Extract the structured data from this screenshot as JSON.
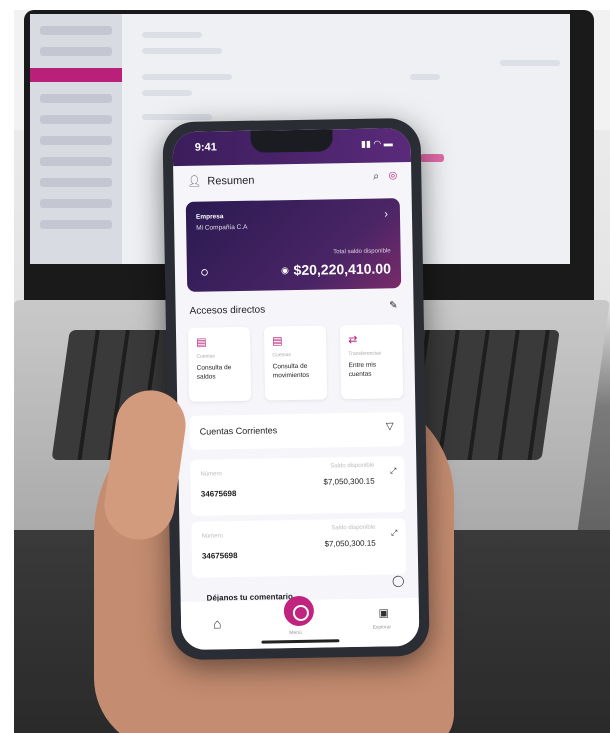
{
  "status": {
    "time": "9:41",
    "signal": "▮▮ ◠ ▬"
  },
  "topbar": {
    "title": "Resumen"
  },
  "card": {
    "company_label": "Empresa",
    "company_name": "Mi Compañía C.A",
    "balance_label": "Total saldo disponible",
    "balance": "$20,220,410.00"
  },
  "shortcuts": {
    "title": "Accesos directos",
    "items": [
      {
        "category": "Cuentas",
        "label": "Consulta de saldos"
      },
      {
        "category": "Cuentas",
        "label": "Consulta de movimientos"
      },
      {
        "category": "Transferencias",
        "label": "Entre mis cuentas"
      }
    ]
  },
  "accounts": {
    "title": "Cuentas Corrientes",
    "items": [
      {
        "number_label": "Número",
        "number": "34675698",
        "balance_label": "Saldo disponible",
        "balance": "$7,050,300.15"
      },
      {
        "number_label": "Número",
        "number": "34675698",
        "balance_label": "Saldo disponible",
        "balance": "$7,050,300.15"
      }
    ]
  },
  "feedback": {
    "label": "Déjanos tu comentario"
  },
  "nav": {
    "menu_label": "Menú",
    "explore_label": "Explorar"
  },
  "colors": {
    "brand": "#c0247f",
    "card": "#2a1a52"
  },
  "icons": [
    "user-icon",
    "search-icon",
    "bell-icon",
    "chevron-right-icon",
    "eye-icon",
    "support-icon",
    "pencil-icon",
    "filter-icon",
    "expand-icon",
    "chat-icon",
    "home-icon",
    "chart-icon"
  ]
}
